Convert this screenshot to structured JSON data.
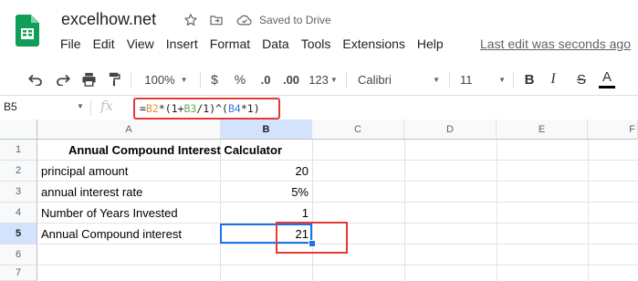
{
  "app": {
    "doc_title": "excelhow.net",
    "save_status": "Saved to Drive",
    "last_edit": "Last edit was seconds ago",
    "brand_color": "#0f9d58"
  },
  "menu": [
    "File",
    "Edit",
    "View",
    "Insert",
    "Format",
    "Data",
    "Tools",
    "Extensions",
    "Help"
  ],
  "toolbar": {
    "zoom": "100%",
    "currency": "$",
    "percent": "%",
    "decrease_decimal": ".0",
    "increase_decimal": ".00",
    "more_formats": "123",
    "font": "Calibri",
    "font_size": "11",
    "bold": "B",
    "italic": "I",
    "strikethrough": "S",
    "text_color": "A"
  },
  "formula_bar": {
    "name_box": "B5",
    "fx": "fx",
    "formula_parts": [
      "=",
      "B2",
      "*(1+",
      "B3",
      "/1)^(",
      "B4",
      "*1)"
    ]
  },
  "sheet": {
    "columns": [
      "A",
      "B",
      "C",
      "D",
      "E",
      "F"
    ],
    "rows": [
      "1",
      "2",
      "3",
      "4",
      "5",
      "6",
      "7"
    ],
    "selected_cell": "B5",
    "cells": {
      "A1": "Annual Compound Interest Calculator",
      "A2": "principal amount",
      "B2": "20",
      "A3": "annual interest rate",
      "B3": "5%",
      "A4": "Number of Years Invested",
      "B4": "1",
      "A5": "Annual Compound interest",
      "B5": "21"
    }
  }
}
